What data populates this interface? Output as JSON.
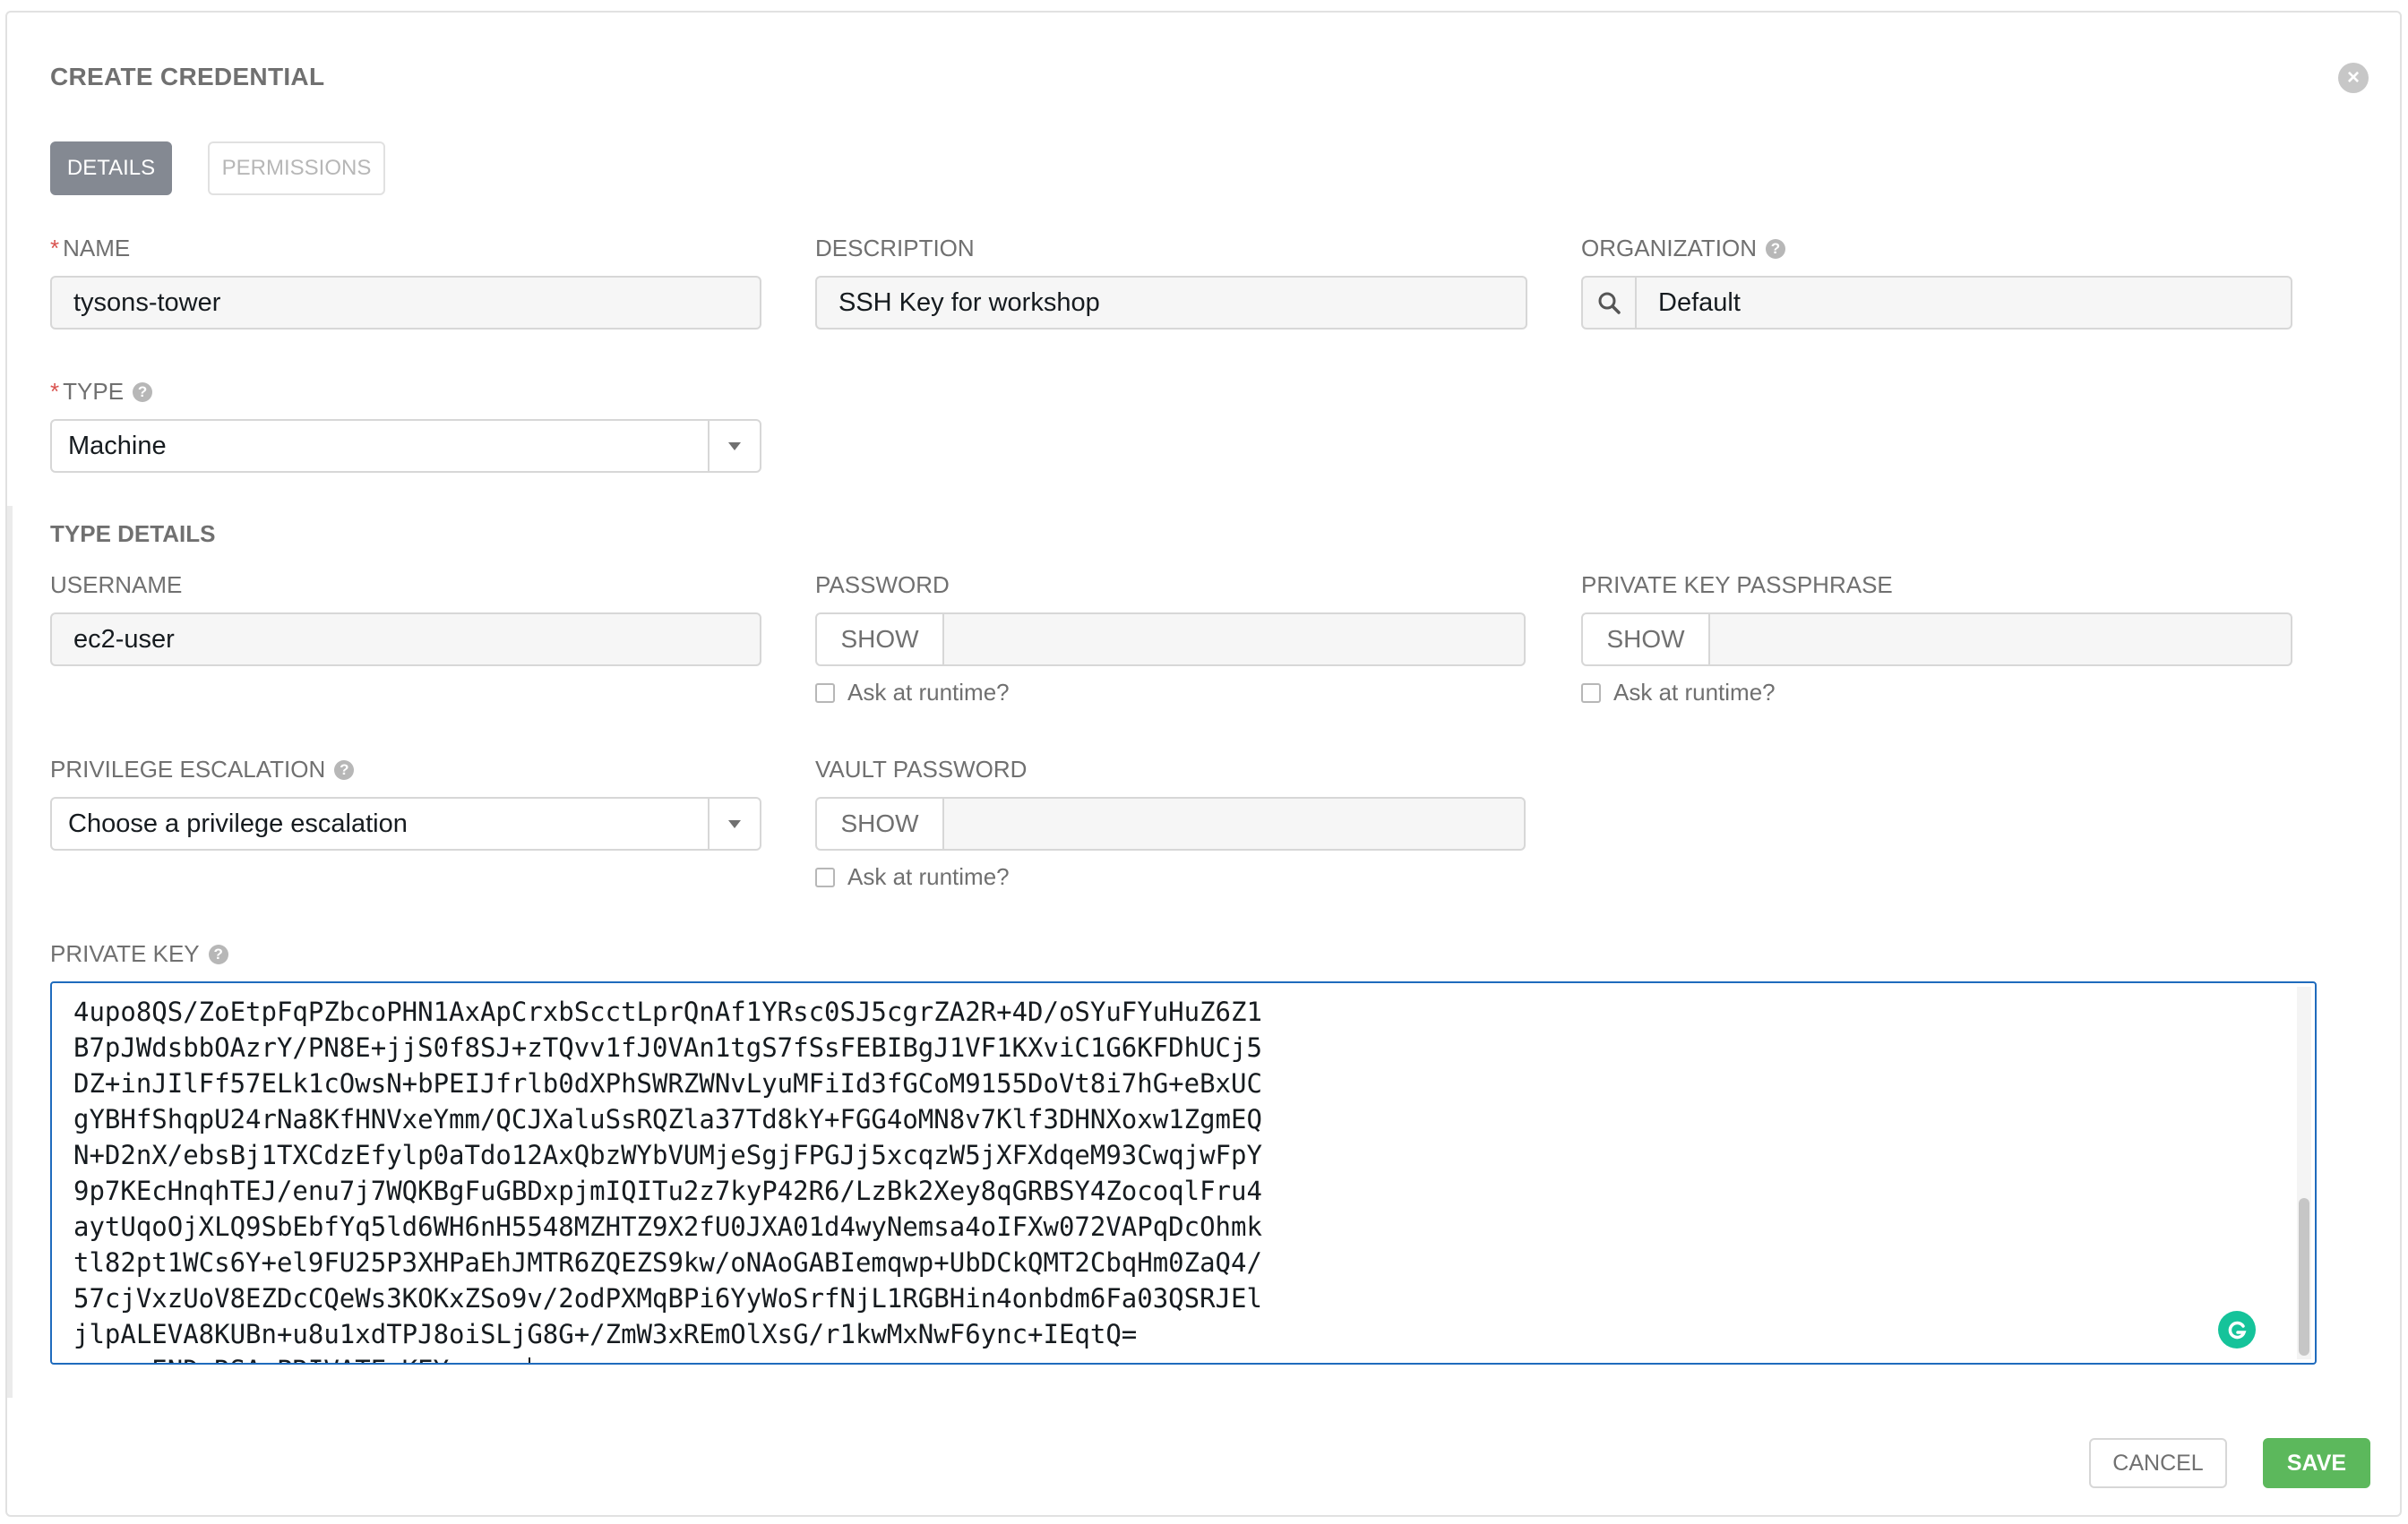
{
  "dialog": {
    "title": "CREATE CREDENTIAL"
  },
  "tabs": [
    {
      "label": "DETAILS",
      "active": true
    },
    {
      "label": "PERMISSIONS",
      "active": false
    }
  ],
  "fields": {
    "name": {
      "label": "NAME",
      "required": true,
      "value": "tysons-tower"
    },
    "description": {
      "label": "DESCRIPTION",
      "value": "SSH Key for workshop"
    },
    "organization": {
      "label": "ORGANIZATION",
      "value": "Default"
    },
    "type": {
      "label": "TYPE",
      "required": true,
      "value": "Machine"
    }
  },
  "type_details": {
    "title": "TYPE DETAILS",
    "username": {
      "label": "USERNAME",
      "value": "ec2-user"
    },
    "password": {
      "label": "PASSWORD",
      "show_label": "SHOW",
      "ask_label": "Ask at runtime?"
    },
    "private_key_passphrase": {
      "label": "PRIVATE KEY PASSPHRASE",
      "show_label": "SHOW",
      "ask_label": "Ask at runtime?"
    },
    "privilege_escalation": {
      "label": "PRIVILEGE ESCALATION",
      "value": "Choose a privilege escalation"
    },
    "vault_password": {
      "label": "VAULT PASSWORD",
      "show_label": "SHOW",
      "ask_label": "Ask at runtime?"
    },
    "private_key": {
      "label": "PRIVATE KEY",
      "lines": [
        "4upo8QS/ZoEtpFqPZbcoPHN1AxApCrxbScctLprQnAf1YRsc0SJ5cgrZA2R+4D/oSYuFYuHuZ6Z1",
        "B7pJWdsbbOAzrY/PN8E+jjS0f8SJ+zTQvv1fJ0VAn1tgS7fSsFEBIBgJ1VF1KXviC1G6KFDhUCj5",
        "DZ+inJIlFf57ELk1cOwsN+bPEIJfrlb0dXPhSWRZWNvLyuMFiId3fGCoM9155DoVt8i7hG+eBxUC",
        "gYBHfShqpU24rNa8KfHNVxeYmm/QCJXaluSsRQZla37Td8kY+FGG4oMN8v7Klf3DHNXoxw1ZgmEQ",
        "N+D2nX/ebsBj1TXCdzEfylp0aTdo12AxQbzWYbVUMjeSgjFPGJj5xcqzW5jXFXdqeM93CwqjwFpY",
        "9p7KEcHnqhTEJ/enu7j7WQKBgFuGBDxpjmIQITu2z7kyP42R6/LzBk2Xey8qGRBSY4ZocoqlFru4",
        "aytUqoOjXLQ9SbEbfYq5ld6WH6nH5548MZHTZ9X2fU0JXA01d4wyNemsa4oIFXw072VAPqDcOhmk",
        "tl82pt1WCs6Y+el9FU25P3XHPaEhJMTR6ZQEZS9kw/oNAoGABIemqwp+UbDCkQMT2CbqHm0ZaQ4/",
        "57cjVxzUoV8EZDcCQeWs3KOKxZSo9v/2odPXMqBPi6YyWoSrfNjL1RGBHin4onbdm6Fa03QSRJEl",
        "jlpALEVA8KUBn+u8u1xdTPJ8oiSLjG8G+/ZmW3xREmOlXsG/r1kwMxNwF6ync+IEqtQ=",
        "-----END RSA PRIVATE KEY-----"
      ]
    }
  },
  "actions": {
    "cancel_label": "CANCEL",
    "save_label": "SAVE"
  },
  "icons": {
    "close": "close-icon",
    "help": "help-icon",
    "search": "search-icon",
    "dropdown": "chevron-down-icon",
    "grammarly": "grammarly-icon"
  },
  "colors": {
    "save": "#5cb85c",
    "focus": "#1f6bbd",
    "tab_active": "#848992",
    "required": "#d9534f"
  }
}
